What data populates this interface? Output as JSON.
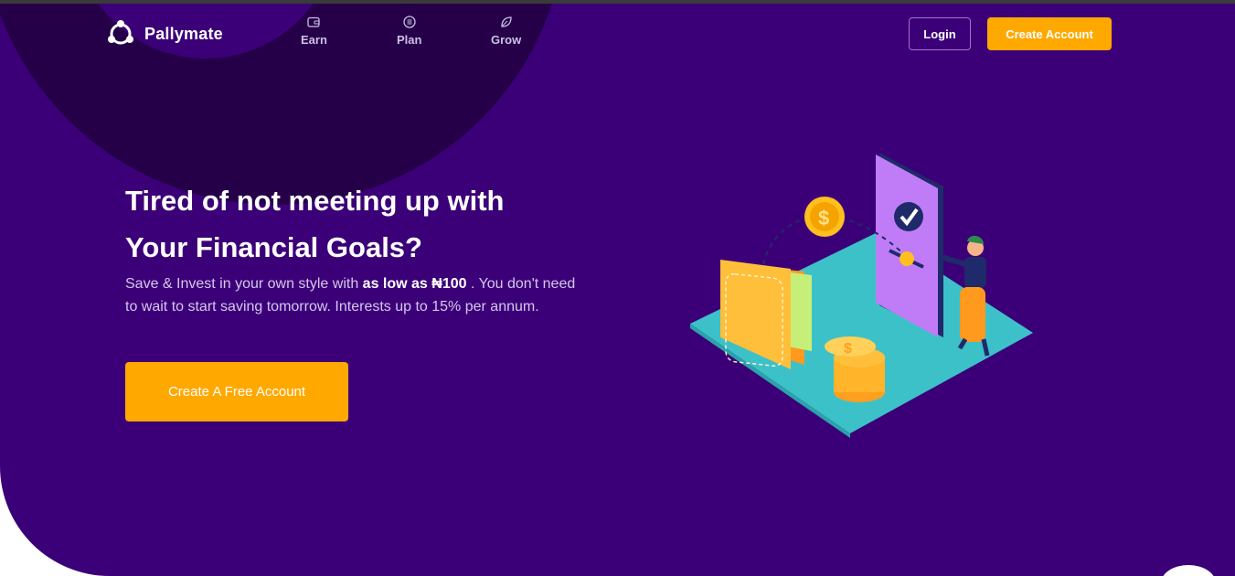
{
  "brand": {
    "name": "Pallymate"
  },
  "nav": {
    "items": [
      {
        "label": "Earn",
        "icon": "wallet-icon"
      },
      {
        "label": "Plan",
        "icon": "list-icon"
      },
      {
        "label": "Grow",
        "icon": "leaf-icon"
      }
    ],
    "login_label": "Login",
    "create_account_label": "Create Account"
  },
  "hero": {
    "headline_line1": "Tired of not meeting up with",
    "headline_line2": "Your Financial Goals?",
    "sub_before": "Save & Invest in your own style with ",
    "sub_bold": "as low as ₦100",
    "sub_after": " . You don't need to wait to start saving tomorrow. Interests up to 15% per annum.",
    "cta_label": "Create A Free Account"
  },
  "colors": {
    "background": "#3b0078",
    "dark_circle": "#250049",
    "accent": "#ffa800",
    "text": "#ffffff",
    "muted_text": "#d7c6ee"
  }
}
